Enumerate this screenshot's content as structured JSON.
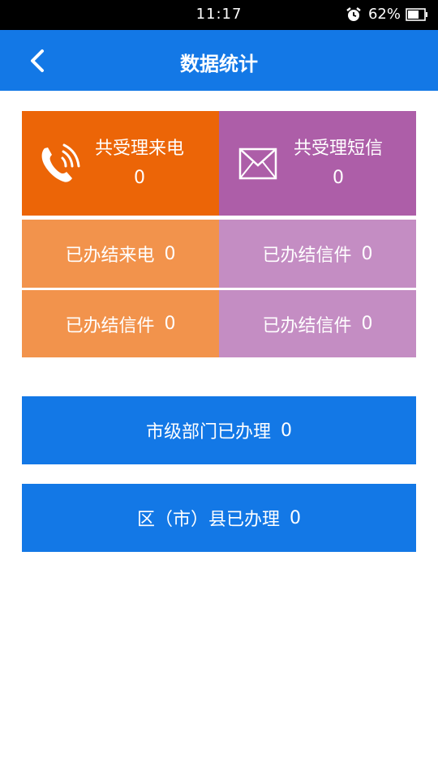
{
  "status": {
    "time": "11:17",
    "battery": "62%"
  },
  "header": {
    "title": "数据统计"
  },
  "stats": {
    "calls_received": {
      "label": "共受理来电",
      "value": "0",
      "icon": "phone-icon"
    },
    "sms_received": {
      "label": "共受理短信",
      "value": "0",
      "icon": "envelope-icon"
    },
    "calls_closed": {
      "label": "已办结来电",
      "value": "0"
    },
    "letters_closed_1": {
      "label": "已办结信件",
      "value": "0"
    },
    "letters_closed_2": {
      "label": "已办结信件",
      "value": "0"
    },
    "letters_closed_3": {
      "label": "已办结信件",
      "value": "0"
    }
  },
  "buttons": {
    "city_dept": {
      "label": "市级部门已办理",
      "value": "0"
    },
    "district": {
      "label": "区（市）县已办理",
      "value": "0"
    }
  },
  "colors": {
    "accent": "#1378e6",
    "orange_dark": "#ec6507",
    "purple_dark": "#ad5ea8",
    "orange": "#f2934c",
    "purple": "#c48dc3"
  }
}
